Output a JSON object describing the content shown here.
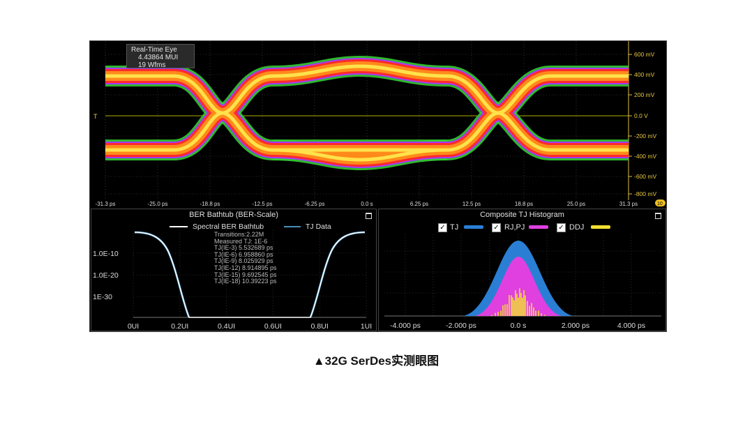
{
  "eye_diagram": {
    "info_box": {
      "title": "Real-Time Eye",
      "mui": "4.43864 MUI",
      "waveforms": "19 Wfms"
    },
    "x_ticks": [
      "-31.3 ps",
      "-25.0 ps",
      "-18.8 ps",
      "-12.5 ps",
      "-6.25 ps",
      "0.0 s",
      "6.25 ps",
      "12.5 ps",
      "18.8 ps",
      "25.0 ps",
      "31.3 ps"
    ],
    "y_ticks": [
      "600 mV",
      "400 mV",
      "200 mV",
      "0.0 V",
      "-200 mV",
      "-400 mV",
      "-600 mV",
      "-800 mV"
    ],
    "marker_left": "T",
    "marker_right": "10",
    "colors": {
      "outer": "#33cc33",
      "purple": "#aa33ff",
      "red": "#ff2a2a",
      "orange": "#ff8a1a",
      "yellow": "#ffe24a",
      "grid": "#555555",
      "zero_line": "#b0b000"
    }
  },
  "bathtub_panel": {
    "title": "BER Bathtub (BER-Scale)",
    "legend": [
      {
        "label": "Spectral BER Bathtub",
        "color": "#ffffff"
      },
      {
        "label": "TJ Data",
        "color": "#4a90b8"
      }
    ],
    "stats": [
      "Transitions:2.22M",
      "Measured TJ: 1E-6",
      "TJ(IE-3) 5.532689 ps",
      "TJ(IE-6) 6.958860 ps",
      "TJ(IE-9) 8.025929 ps",
      "TJ(IE-12) 8.914895 ps",
      "TJ(IE-15) 9.692545 ps",
      "TJ(IE-18) 10.39223 ps"
    ],
    "y_ticks": [
      "1.0E-10",
      "1.0E-20",
      "1E-30"
    ],
    "x_ticks": [
      "0UI",
      "0.2UI",
      "0.4UI",
      "0.6UI",
      "0.8UI",
      "1UI"
    ]
  },
  "histogram_panel": {
    "title": "Composite TJ Histogram",
    "legend": [
      {
        "label": "TJ",
        "color": "#2a7fd4",
        "checked": true
      },
      {
        "label": "RJ,PJ",
        "color": "#e040e0",
        "checked": true
      },
      {
        "label": "DDJ",
        "color": "#f2e030",
        "checked": true
      }
    ],
    "x_ticks": [
      "-4.000 ps",
      "-2.000 ps",
      "0.0 s",
      "2.000 ps",
      "4.000 ps"
    ]
  },
  "caption": "▲32G SerDes实测眼图"
}
